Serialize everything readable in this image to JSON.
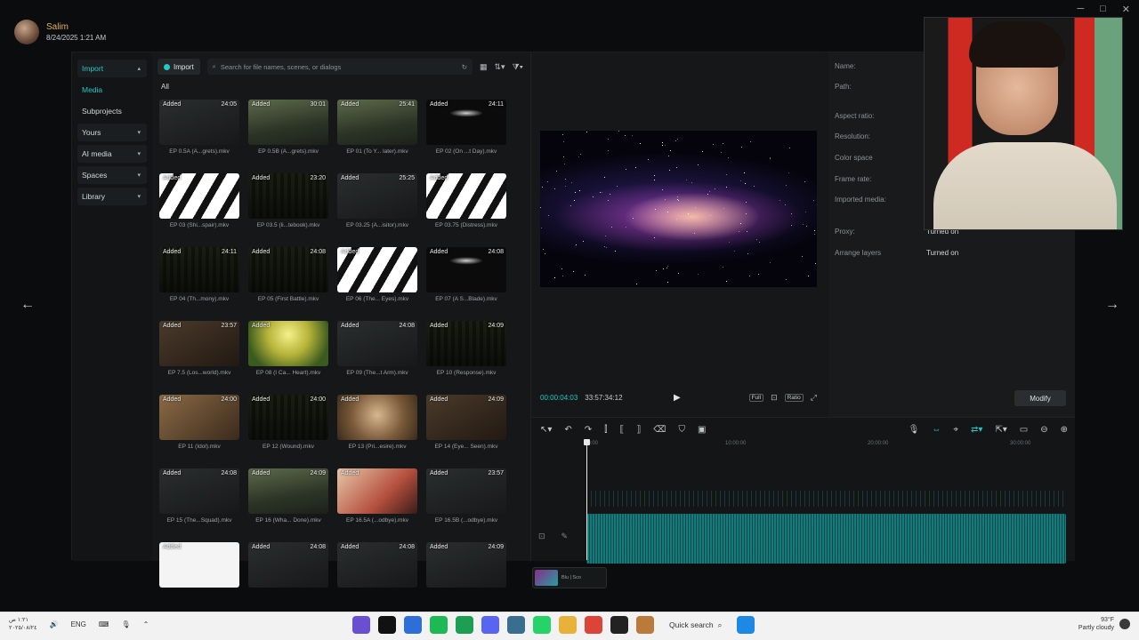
{
  "overlay": {
    "user_name": "Salim",
    "user_date": "8/24/2025 1:21 AM",
    "nav_prev": "←",
    "nav_next": "→",
    "win_min": "─",
    "win_max": "□",
    "win_close": "✕"
  },
  "left_nav": {
    "items": [
      {
        "label": "Import",
        "chev": "▴"
      },
      {
        "label": "Media"
      },
      {
        "label": "Subprojects"
      },
      {
        "label": "Yours",
        "chev": "▾"
      },
      {
        "label": "AI media",
        "chev": "▾"
      },
      {
        "label": "Spaces",
        "chev": "▾"
      },
      {
        "label": "Library",
        "chev": "▾"
      }
    ]
  },
  "media": {
    "import_label": "Import",
    "search_placeholder": "Search for file names, scenes, or dialogs",
    "all_label": "All",
    "added_label": "Added",
    "tiles": [
      {
        "name": "EP 0.5A (A...grets).mkv",
        "dur": "24:05",
        "style": "dark"
      },
      {
        "name": "EP 0.5B (A...grets).mkv",
        "dur": "30:01",
        "style": "forest"
      },
      {
        "name": "EP 01 (To Y... later).mkv",
        "dur": "25:41",
        "style": "forest"
      },
      {
        "name": "EP 02 (On ...t Day).mkv",
        "dur": "24:11",
        "style": "ship"
      },
      {
        "name": "EP 03 (Shi...spair).mkv",
        "dur": "",
        "style": "stripe"
      },
      {
        "name": "EP 03.5 (li...tebook).mkv",
        "dur": "23:20",
        "style": "crowd"
      },
      {
        "name": "EP 03.25 (A...isitor).mkv",
        "dur": "25:25",
        "style": "dark"
      },
      {
        "name": "EP 03.75 (Distress).mkv",
        "dur": "",
        "style": "stripe"
      },
      {
        "name": "EP 04 (Th...mony).mkv",
        "dur": "24:11",
        "style": "crowd"
      },
      {
        "name": "EP 05 (First Battle).mkv",
        "dur": "24:08",
        "style": "crowd"
      },
      {
        "name": "EP 06 (The... Eyes).mkv",
        "dur": "",
        "style": "stripe"
      },
      {
        "name": "EP 07 (A S...Blade).mkv",
        "dur": "24:08",
        "style": "ship"
      },
      {
        "name": "EP 7.5 (Los...world).mkv",
        "dur": "23:57",
        "style": "brown"
      },
      {
        "name": "EP 08 (I Ca... Heart).mkv",
        "dur": "",
        "style": "bright"
      },
      {
        "name": "EP 09 (The...t Arm).mkv",
        "dur": "24:08",
        "style": "dark"
      },
      {
        "name": "EP 10 (Response).mkv",
        "dur": "24:09",
        "style": "crowd"
      },
      {
        "name": "EP 11 (Idol).mkv",
        "dur": "24:00",
        "style": "gold"
      },
      {
        "name": "EP 12 (Wound).mkv",
        "dur": "24:00",
        "style": "crowd"
      },
      {
        "name": "EP 13 (Pri...esire).mkv",
        "dur": "",
        "style": "face"
      },
      {
        "name": "EP 14 (Eye... Seen).mkv",
        "dur": "24:09",
        "style": "brown"
      },
      {
        "name": "EP 15 (The...Squad).mkv",
        "dur": "24:08",
        "style": "dark"
      },
      {
        "name": "EP 16 (Wha... Done).mkv",
        "dur": "24:09",
        "style": "forest"
      },
      {
        "name": "EP 16.5A (...odbye).mkv",
        "dur": "",
        "style": "anime"
      },
      {
        "name": "EP 16.5B (...odbye).mkv",
        "dur": "23:57",
        "style": "dark"
      },
      {
        "name": "",
        "dur": "",
        "style": "white"
      },
      {
        "name": "",
        "dur": "24:08",
        "style": "dark"
      },
      {
        "name": "",
        "dur": "24:08",
        "style": "dark"
      },
      {
        "name": "",
        "dur": "24:09",
        "style": "dark"
      }
    ]
  },
  "player": {
    "current_time": "00:00:04:03",
    "total_time": "33:57:34:12",
    "full_label": "Full",
    "ratio_label": "Ratio"
  },
  "details": {
    "rows": [
      {
        "label": "Name:",
        "value": ""
      },
      {
        "label": "Path:",
        "value": ""
      },
      {
        "label": "Aspect ratio:",
        "value": ""
      },
      {
        "label": "Resolution:",
        "value": ""
      },
      {
        "label": "Color space",
        "value": ""
      },
      {
        "label": "Frame rate:",
        "value": ""
      },
      {
        "label": "Imported media:",
        "value": ""
      },
      {
        "label": "Proxy:",
        "value": "Turned on"
      },
      {
        "label": "Arrange layers",
        "value": "Turned on"
      }
    ],
    "modify_label": "Modify"
  },
  "timeline": {
    "ruler": [
      "00:00",
      "10:00:00",
      "20:00:00",
      "30:00:00"
    ]
  },
  "dock": {
    "label": "Blu | Sco"
  },
  "taskbar": {
    "clock_line1": "١:٢١ ص",
    "clock_line2": "٢٠٢٥/٠٨/٢٤",
    "lang": "ENG",
    "quick_search": "Quick search",
    "temp": "93°F",
    "condition": "Partly cloudy",
    "apps": [
      {
        "icon": "calendar-icon",
        "color": "#6b4fd1"
      },
      {
        "icon": "capcut-icon",
        "color": "#111111"
      },
      {
        "icon": "shield-icon",
        "color": "#2d6fd6"
      },
      {
        "icon": "spotify-icon",
        "color": "#1db954"
      },
      {
        "icon": "game-icon",
        "color": "#1e9e52"
      },
      {
        "icon": "discord-icon",
        "color": "#5865f2"
      },
      {
        "icon": "browser-icon",
        "color": "#3a6e8f"
      },
      {
        "icon": "whatsapp-icon",
        "color": "#25d366"
      },
      {
        "icon": "folder-icon",
        "color": "#e8b23a"
      },
      {
        "icon": "chrome-icon",
        "color": "#db4437"
      },
      {
        "icon": "terminal-icon",
        "color": "#222222"
      },
      {
        "icon": "game-thumb-icon",
        "color": "#b97a3a"
      }
    ]
  },
  "colors": {
    "accent": "#24c6c6",
    "username": "#e8b058",
    "clip": "#157a7a"
  }
}
